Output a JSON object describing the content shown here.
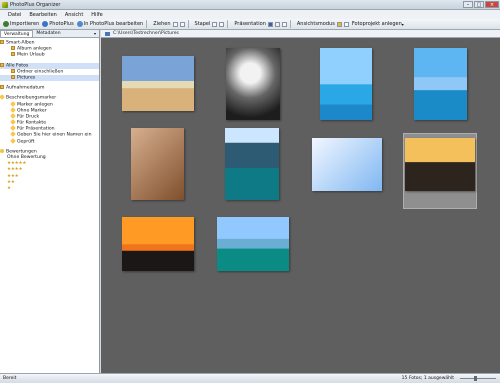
{
  "window": {
    "title": "PhotoPlus Organizer"
  },
  "menu": [
    "Datei",
    "Bearbeiten",
    "Ansicht",
    "Hilfe"
  ],
  "toolbar": {
    "import": "Importieren",
    "photoplus": "PhotoPlus",
    "edit": "In PhotoPlus bearbeiten",
    "pull": "Ziehen",
    "stack": "Stapel",
    "presentation": "Präsentation",
    "viewmode": "Ansichtsmodus",
    "project": "Fotoprojekt anlegen"
  },
  "sidebar": {
    "tabs": [
      "Verwaltung",
      "Metadaten"
    ],
    "groups": [
      {
        "label": "Smart-Alben",
        "items": [
          "Album anlegen",
          "Mein Urlaub"
        ]
      },
      {
        "label": "Alle Fotos",
        "items": [
          "Ordner einschließen",
          "Pictures"
        ]
      },
      {
        "label": "Aufnahmedatum",
        "items": []
      },
      {
        "label": "Beschreibungsmarker",
        "items": [
          "Marker anlegen",
          "Ohne Marker",
          "Für Druck",
          "Für Kontakte",
          "Für Präsentation",
          "Geben Sie hier einen Namen ein",
          "Geprüft"
        ]
      },
      {
        "label": "Bewertungen",
        "items": [
          "Ohne Bewertung",
          "★★★★★",
          "★★★★",
          "★★★",
          "★★",
          "★"
        ]
      }
    ]
  },
  "content": {
    "path": "C:\\Users\\Testrechner\\Pictures"
  },
  "status": {
    "left": "Bereit",
    "right": "15 Fotos; 1 ausgewählt"
  },
  "photos": [
    {
      "name": "beach",
      "colors": [
        "#7aa4d8",
        "#d9b17b"
      ]
    },
    {
      "name": "palm-silhouette",
      "colors": [
        "#f2f2f2",
        "#1d1d1d"
      ]
    },
    {
      "name": "resort-pool",
      "colors": [
        "#8fd0ff",
        "#1d88c9"
      ]
    },
    {
      "name": "palm-pool",
      "colors": [
        "#5db6f1",
        "#1b8bc8"
      ]
    },
    {
      "name": "antelope",
      "colors": [
        "#c79a73",
        "#7f4f2d"
      ]
    },
    {
      "name": "river-waterfall",
      "colors": [
        "#cde6ff",
        "#0d7a86"
      ]
    },
    {
      "name": "seagull",
      "colors": [
        "#e7f2ff",
        "#7fb7f2"
      ]
    },
    {
      "name": "sunset-sailboat",
      "colors": [
        "#f4c05b",
        "#1f1f1f"
      ]
    },
    {
      "name": "sunset-sea",
      "colors": [
        "#ff9b25",
        "#1b1717"
      ]
    },
    {
      "name": "island",
      "colors": [
        "#91c8ff",
        "#0a8b83"
      ]
    }
  ]
}
